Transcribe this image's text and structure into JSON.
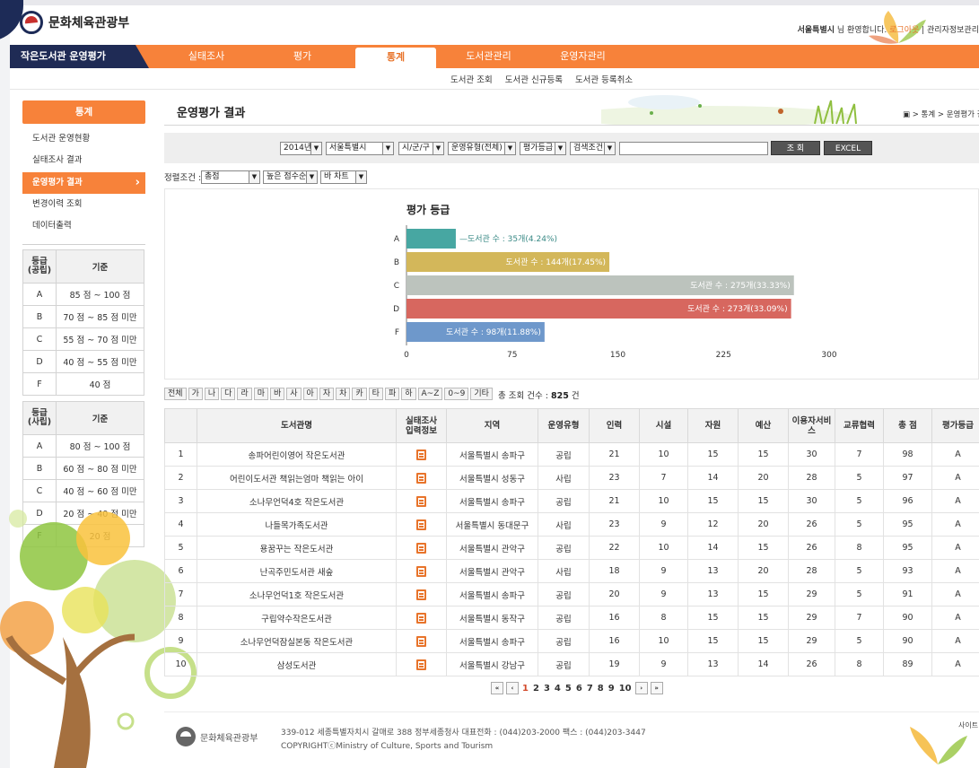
{
  "site": {
    "logo_text": "문화체육관광부",
    "brand": "작은도서관 운영평가"
  },
  "userbar": {
    "user": "서울특별시",
    "welcome": " 님 환영합니다. ",
    "logout": "로그아웃",
    "sep": " | ",
    "admin": "관리자정보관리"
  },
  "nav": [
    {
      "label": "실태조사",
      "active": false
    },
    {
      "label": "평가",
      "active": false
    },
    {
      "label": "통계",
      "active": true
    },
    {
      "label": "도서관관리",
      "active": false
    },
    {
      "label": "운영자관리",
      "active": false
    }
  ],
  "subnav": [
    "도서관 조회",
    "도서관 신규등록",
    "도서관 등록취소"
  ],
  "left": {
    "title": "통계",
    "menu": [
      {
        "label": "도서관 운영현황",
        "on": false
      },
      {
        "label": "실태조사 결과",
        "on": false
      },
      {
        "label": "운영평가 결과",
        "on": true
      },
      {
        "label": "변경이력 조회",
        "on": false
      },
      {
        "label": "데이터출력",
        "on": false
      }
    ],
    "grade_public": {
      "head": [
        "등급\n(공립)",
        "기준"
      ],
      "rows": [
        [
          "A",
          "85 점 ~ 100 점"
        ],
        [
          "B",
          "70 점 ~ 85 점 미만"
        ],
        [
          "C",
          "55 점 ~ 70 점 미만"
        ],
        [
          "D",
          "40 점 ~ 55 점 미만"
        ],
        [
          "F",
          "40 점"
        ]
      ]
    },
    "grade_private": {
      "head": [
        "등급\n(사립)",
        "기준"
      ],
      "rows": [
        [
          "A",
          "80 점 ~ 100 점"
        ],
        [
          "B",
          "60 점 ~ 80 점 미만"
        ],
        [
          "C",
          "40 점 ~ 60 점 미만"
        ],
        [
          "D",
          "20 점 ~ 40 점 미만"
        ],
        [
          "F",
          "20 점"
        ]
      ]
    }
  },
  "content": {
    "title": "운영평가 결과",
    "breadcrumb": "▣ > 통계 > 운영평가 결과"
  },
  "filters": {
    "year": "2014년",
    "city": "서울특별시",
    "district": "시/군/구",
    "type": "운영유형(전체)",
    "grade": "평가등급",
    "cond": "검색조건",
    "search_value": "",
    "search_btn": "조 회",
    "excel_btn": "EXCEL"
  },
  "sort": {
    "label": "정렬조건 :",
    "field": "총점",
    "order": "높은 점수순",
    "chart": "바 차트"
  },
  "chart_data": {
    "type": "bar",
    "orientation": "horizontal",
    "title": "평가 등급",
    "categories": [
      "A",
      "B",
      "C",
      "D",
      "F"
    ],
    "values": [
      35,
      144,
      275,
      273,
      98
    ],
    "labels": [
      "도서관 수 : 35개(4.24%)",
      "도서관 수 : 144개(17.45%)",
      "도서관 수 : 275개(33.33%)",
      "도서관 수 : 273개(33.09%)",
      "도서관 수 : 98개(11.88%)"
    ],
    "colors": [
      "#47a7a2",
      "#d3b75a",
      "#bcc3bd",
      "#d7675f",
      "#6e98cb"
    ],
    "xlim": [
      0,
      300
    ],
    "xticks": [
      0,
      75,
      150,
      225,
      300
    ],
    "grid": false
  },
  "alpha": [
    "전체",
    "가",
    "나",
    "다",
    "라",
    "마",
    "바",
    "사",
    "아",
    "자",
    "차",
    "카",
    "타",
    "파",
    "하",
    "A~Z",
    "0~9",
    "기타"
  ],
  "count": {
    "label": "총 조회 건수 : ",
    "value": "825",
    "unit": " 건"
  },
  "table": {
    "headers": [
      "",
      "도서관명",
      "실태조사\n입력정보",
      "지역",
      "운영유형",
      "인력",
      "시설",
      "자원",
      "예산",
      "이용자서비\n스",
      "교류협력",
      "총 점",
      "평가등급"
    ],
    "rows": [
      [
        "1",
        "송파어린이영어 작은도서관",
        "서울특별시 송파구",
        "공립",
        "21",
        "10",
        "15",
        "15",
        "30",
        "7",
        "98",
        "A"
      ],
      [
        "2",
        "어린이도서관 책읽는엄마 책읽는 아이",
        "서울특별시 성동구",
        "사립",
        "23",
        "7",
        "14",
        "20",
        "28",
        "5",
        "97",
        "A"
      ],
      [
        "3",
        "소나무언덕4호 작은도서관",
        "서울특별시 송파구",
        "공립",
        "21",
        "10",
        "15",
        "15",
        "30",
        "5",
        "96",
        "A"
      ],
      [
        "4",
        "나들목가족도서관",
        "서울특별시 동대문구",
        "사립",
        "23",
        "9",
        "12",
        "20",
        "26",
        "5",
        "95",
        "A"
      ],
      [
        "5",
        "용꿈꾸는 작은도서관",
        "서울특별시 관악구",
        "공립",
        "22",
        "10",
        "14",
        "15",
        "26",
        "8",
        "95",
        "A"
      ],
      [
        "6",
        "난곡주민도서관 새숲",
        "서울특별시 관악구",
        "사립",
        "18",
        "9",
        "13",
        "20",
        "28",
        "5",
        "93",
        "A"
      ],
      [
        "7",
        "소나무언덕1호 작은도서관",
        "서울특별시 송파구",
        "공립",
        "20",
        "9",
        "13",
        "15",
        "29",
        "5",
        "91",
        "A"
      ],
      [
        "8",
        "구립약수작은도서관",
        "서울특별시 동작구",
        "공립",
        "16",
        "8",
        "15",
        "15",
        "29",
        "7",
        "90",
        "A"
      ],
      [
        "9",
        "소나무언덕잠실본동 작은도서관",
        "서울특별시 송파구",
        "공립",
        "16",
        "10",
        "15",
        "15",
        "29",
        "5",
        "90",
        "A"
      ],
      [
        "10",
        "삼성도서관",
        "서울특별시 강남구",
        "공립",
        "19",
        "9",
        "13",
        "14",
        "26",
        "8",
        "89",
        "A"
      ]
    ]
  },
  "pager": {
    "first": "«",
    "prev": "‹",
    "next": "›",
    "last": "»",
    "pages": [
      "1",
      "2",
      "3",
      "4",
      "5",
      "6",
      "7",
      "8",
      "9",
      "10"
    ],
    "current": "1"
  },
  "footer": {
    "logo": "문화체육관광부",
    "address": "339-012 세종특별자치시 갈매로 388 정부세종청사 대표전화 : (044)203-2000 팩스 : (044)203-3447",
    "copyright": "COPYRIGHTⓒMinistry of Culture, Sports and Tourism",
    "sitemap": "사이트"
  }
}
